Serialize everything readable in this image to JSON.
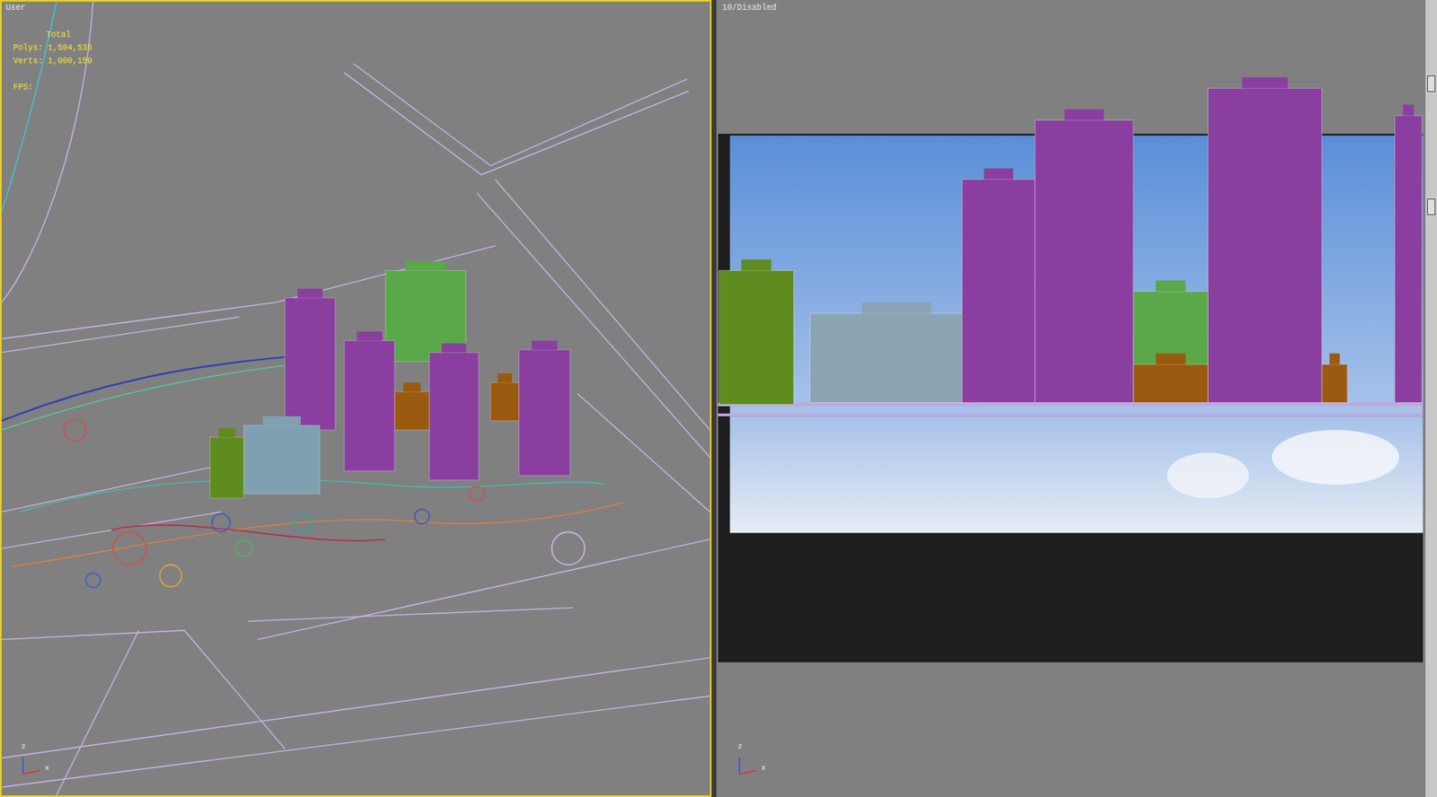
{
  "viewports": [
    {
      "label": "User",
      "kind": "perspective",
      "active": true,
      "axis_labels": [
        "z",
        "x"
      ]
    },
    {
      "label": "10/Disabled",
      "kind": "camera",
      "active": false,
      "axis_labels": [
        "z",
        "x"
      ]
    }
  ],
  "stats": {
    "title": "Total",
    "polys": "Polys: 1,504,536",
    "verts": "Verts: 1,000,159",
    "fps": "FPS:"
  }
}
